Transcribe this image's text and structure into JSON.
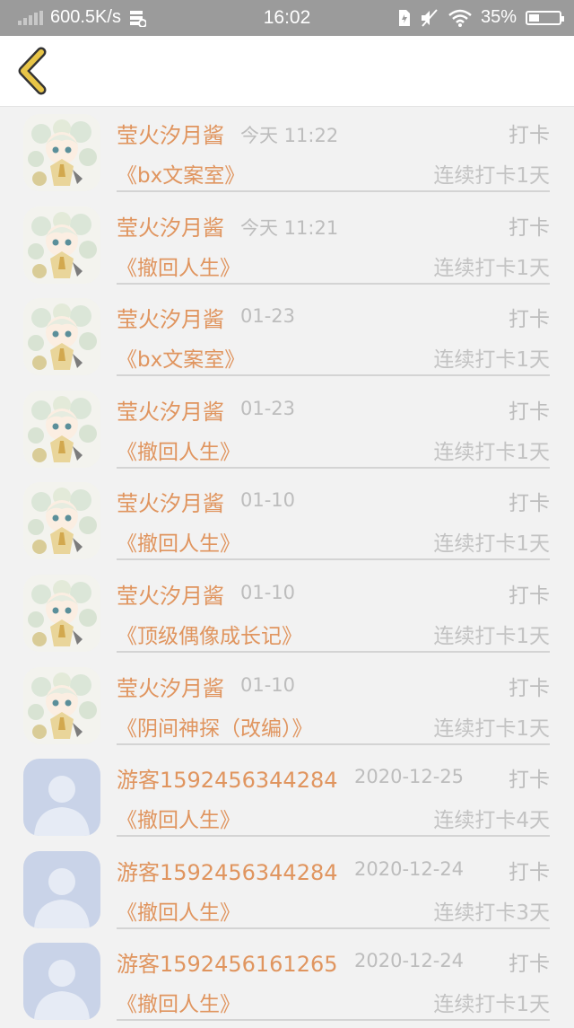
{
  "status_bar": {
    "speed": "600.5K/s",
    "time": "16:02",
    "battery": "35%",
    "battery_level": 0.35
  },
  "colors": {
    "accent": "#e0955f",
    "back_icon": "#e8c547",
    "muted_text": "#bdbdbd",
    "divider": "#d4d4d4"
  },
  "records": [
    {
      "name": "莹火汐月酱",
      "time": "今天 11:22",
      "action": "打卡",
      "book": "《bx文案室》",
      "streak": "连续打卡1天",
      "avatar": "anime"
    },
    {
      "name": "莹火汐月酱",
      "time": "今天 11:21",
      "action": "打卡",
      "book": "《撤回人生》",
      "streak": "连续打卡1天",
      "avatar": "anime"
    },
    {
      "name": "莹火汐月酱",
      "time": "01-23",
      "action": "打卡",
      "book": "《bx文案室》",
      "streak": "连续打卡1天",
      "avatar": "anime"
    },
    {
      "name": "莹火汐月酱",
      "time": "01-23",
      "action": "打卡",
      "book": "《撤回人生》",
      "streak": "连续打卡1天",
      "avatar": "anime"
    },
    {
      "name": "莹火汐月酱",
      "time": "01-10",
      "action": "打卡",
      "book": "《撤回人生》",
      "streak": "连续打卡1天",
      "avatar": "anime"
    },
    {
      "name": "莹火汐月酱",
      "time": "01-10",
      "action": "打卡",
      "book": "《顶级偶像成长记》",
      "streak": "连续打卡1天",
      "avatar": "anime"
    },
    {
      "name": "莹火汐月酱",
      "time": "01-10",
      "action": "打卡",
      "book": "《阴间神探（改编）》",
      "streak": "连续打卡1天",
      "avatar": "anime"
    },
    {
      "name": "游客1592456344284",
      "time": "2020-12-25",
      "action": "打卡",
      "book": "《撤回人生》",
      "streak": "连续打卡4天",
      "avatar": "default"
    },
    {
      "name": "游客1592456344284",
      "time": "2020-12-24",
      "action": "打卡",
      "book": "《撤回人生》",
      "streak": "连续打卡3天",
      "avatar": "default"
    },
    {
      "name": "游客1592456161265",
      "time": "2020-12-24",
      "action": "打卡",
      "book": "《撤回人生》",
      "streak": "连续打卡1天",
      "avatar": "default"
    }
  ]
}
